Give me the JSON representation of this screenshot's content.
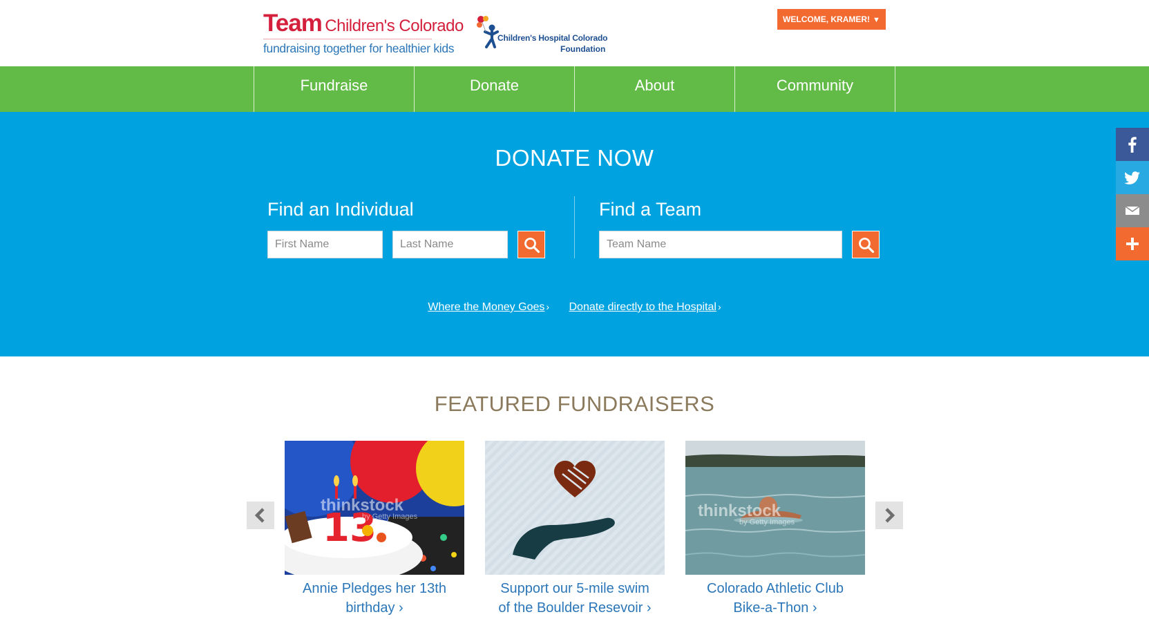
{
  "header": {
    "logo_team_word": "Team",
    "logo_team_name": "Children's Colorado",
    "logo_tagline": "fundraising together for healthier kids",
    "foundation_line1": "Children's Hospital Colorado",
    "foundation_line2": "Foundation",
    "welcome_label": "WELCOME, KRAMER!",
    "welcome_caret": "▼"
  },
  "nav": {
    "items": [
      "Fundraise",
      "Donate",
      "About",
      "Community"
    ]
  },
  "donate": {
    "title": "DONATE NOW",
    "find_individual": "Find an Individual",
    "find_team": "Find a Team",
    "first_name_placeholder": "First Name",
    "last_name_placeholder": "Last Name",
    "team_name_placeholder": "Team Name",
    "link_money": "Where the Money Goes",
    "link_hospital": "Donate directly to the Hospital",
    "chevron": "›"
  },
  "social": [
    "facebook-icon",
    "twitter-icon",
    "email-icon",
    "plus-icon"
  ],
  "featured": {
    "title": "FEATURED FUNDRAISERS",
    "cards": [
      {
        "caption_line1": "Annie Pledges her 13th",
        "caption_line2": "birthday ›",
        "watermark": "thinkstock",
        "watermark_sub": "by Getty Images"
      },
      {
        "caption_line1": "Support our 5-mile swim",
        "caption_line2": "of the Boulder Resevoir ›"
      },
      {
        "caption_line1": "Colorado Athletic Club",
        "caption_line2": "Bike-a-Thon ›",
        "watermark": "thinkstock",
        "watermark_sub": "by Getty Images"
      }
    ]
  },
  "colors": {
    "nav_green": "#63bb47",
    "donate_blue": "#00a3e0",
    "accent_orange": "#f26a30",
    "link_blue": "#2a76b8",
    "brand_red": "#d4203c"
  }
}
